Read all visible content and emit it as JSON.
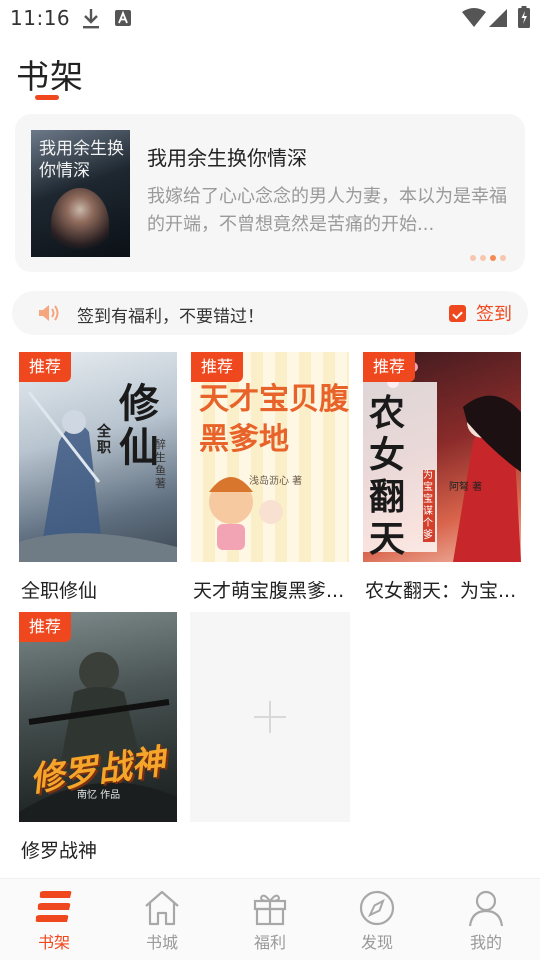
{
  "status_bar": {
    "time": "11:16",
    "icons": [
      "download-icon",
      "a-notification-icon",
      "wifi-icon",
      "signal-icon",
      "battery-icon"
    ]
  },
  "page": {
    "title": "书架",
    "accent_color": "#f0481e"
  },
  "recommend": {
    "cover_text": "我用余生换你情深",
    "title": "我用余生换你情深",
    "description": "我嫁给了心心念念的男人为妻，本以为是幸福的开端，不曾想竟然是苦痛的开始...",
    "dots_count": 4,
    "active_dot": 3
  },
  "signin": {
    "icon": "speaker-icon",
    "message": "签到有福利，不要错过！",
    "button_icon": "calendar-check-icon",
    "button_label": "签到"
  },
  "books": [
    {
      "name": "全职修仙",
      "tag": "推荐",
      "cover_text": "修仙",
      "cover_sub": "全职",
      "author": "醉生鱼 著"
    },
    {
      "name": "天才萌宝腹黑爹...",
      "tag": "推荐",
      "cover_text": "天才宝贝腹黑爹地",
      "author": "浅岛沥心 著"
    },
    {
      "name": "农女翻天：为宝...",
      "tag": "推荐",
      "cover_text": "农女翻天",
      "cover_sub": "为宝宝谋个爹",
      "author": "阿弩 著"
    },
    {
      "name": "修罗战神",
      "tag": "推荐",
      "cover_text": "修罗战神",
      "author": "南忆 作品"
    }
  ],
  "add_slot": {
    "icon": "plus-icon"
  },
  "bottom_nav": [
    {
      "label": "书架",
      "icon": "bookshelf-icon",
      "active": true
    },
    {
      "label": "书城",
      "icon": "home-icon",
      "active": false
    },
    {
      "label": "福利",
      "icon": "gift-icon",
      "active": false
    },
    {
      "label": "发现",
      "icon": "compass-icon",
      "active": false
    },
    {
      "label": "我的",
      "icon": "user-icon",
      "active": false
    }
  ]
}
